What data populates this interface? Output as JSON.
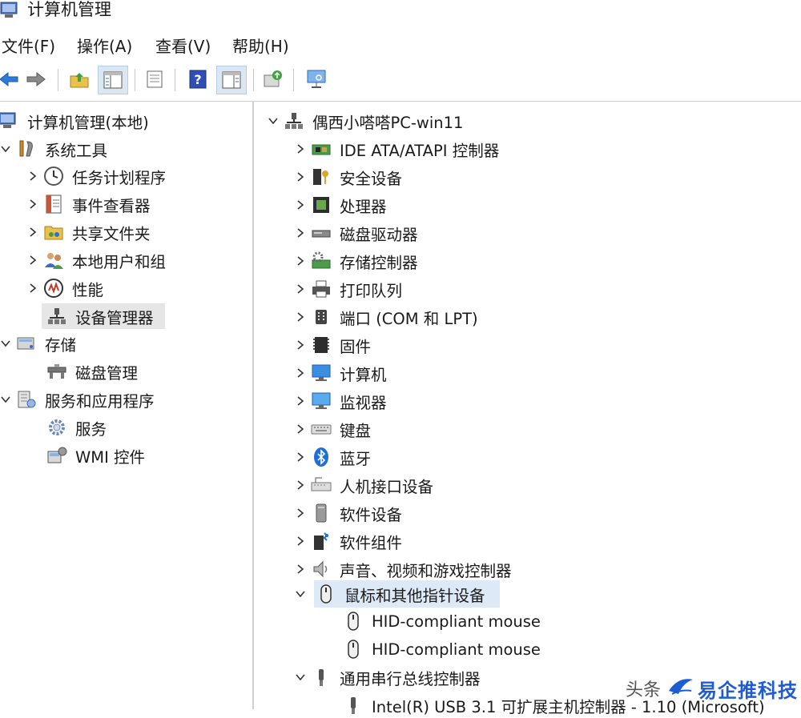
{
  "window": {
    "title": "计算机管理"
  },
  "menu": [
    {
      "label": "文件(F)"
    },
    {
      "label": "操作(A)"
    },
    {
      "label": "查看(V)"
    },
    {
      "label": "帮助(H)"
    }
  ],
  "toolbar": {
    "buttons": [
      "back-arrow-icon",
      "forward-arrow-icon",
      "up-folder-icon",
      "show-tree-icon",
      "properties-icon",
      "help-icon",
      "action-pane-icon",
      "update-driver-icon",
      "scan-hardware-icon"
    ],
    "active": [
      "show-tree-icon",
      "action-pane-icon"
    ]
  },
  "left_tree": [
    {
      "label": "计算机管理(本地)",
      "icon": "computer-management-icon",
      "expander": "none"
    },
    {
      "label": "系统工具",
      "icon": "system-tools-icon",
      "expander": "expanded"
    },
    {
      "label": "任务计划程序",
      "icon": "clock-icon",
      "expander": "collapsed"
    },
    {
      "label": "事件查看器",
      "icon": "event-viewer-icon",
      "expander": "collapsed"
    },
    {
      "label": "共享文件夹",
      "icon": "shared-folder-icon",
      "expander": "collapsed"
    },
    {
      "label": "本地用户和组",
      "icon": "users-icon",
      "expander": "collapsed"
    },
    {
      "label": "性能",
      "icon": "performance-icon",
      "expander": "collapsed"
    },
    {
      "label": "设备管理器",
      "icon": "device-manager-icon",
      "expander": "none",
      "selected": true
    },
    {
      "label": "存储",
      "icon": "storage-icon",
      "expander": "expanded"
    },
    {
      "label": "磁盘管理",
      "icon": "disk-management-icon",
      "expander": "none"
    },
    {
      "label": "服务和应用程序",
      "icon": "services-apps-icon",
      "expander": "expanded"
    },
    {
      "label": "服务",
      "icon": "gear-icon",
      "expander": "none"
    },
    {
      "label": "WMI 控件",
      "icon": "wmi-icon",
      "expander": "none"
    }
  ],
  "right_tree": [
    {
      "label": "偶西小嗒嗒PC-win11",
      "icon": "computer-root-icon",
      "expander": "expanded"
    },
    {
      "label": "IDE ATA/ATAPI 控制器",
      "icon": "ide-controller-icon",
      "expander": "collapsed"
    },
    {
      "label": "安全设备",
      "icon": "security-device-icon",
      "expander": "collapsed"
    },
    {
      "label": "处理器",
      "icon": "processor-icon",
      "expander": "collapsed"
    },
    {
      "label": "磁盘驱动器",
      "icon": "disk-drive-icon",
      "expander": "collapsed"
    },
    {
      "label": "存储控制器",
      "icon": "storage-controller-icon",
      "expander": "collapsed"
    },
    {
      "label": "打印队列",
      "icon": "printer-icon",
      "expander": "collapsed"
    },
    {
      "label": "端口 (COM 和 LPT)",
      "icon": "port-icon",
      "expander": "collapsed"
    },
    {
      "label": "固件",
      "icon": "firmware-icon",
      "expander": "collapsed"
    },
    {
      "label": "计算机",
      "icon": "computer-icon",
      "expander": "collapsed"
    },
    {
      "label": "监视器",
      "icon": "monitor-icon",
      "expander": "collapsed"
    },
    {
      "label": "键盘",
      "icon": "keyboard-icon",
      "expander": "collapsed"
    },
    {
      "label": "蓝牙",
      "icon": "bluetooth-icon",
      "expander": "collapsed"
    },
    {
      "label": "人机接口设备",
      "icon": "hid-icon",
      "expander": "collapsed"
    },
    {
      "label": "软件设备",
      "icon": "software-device-icon",
      "expander": "collapsed"
    },
    {
      "label": "软件组件",
      "icon": "software-component-icon",
      "expander": "collapsed"
    },
    {
      "label": "声音、视频和游戏控制器",
      "icon": "speaker-icon",
      "expander": "collapsed"
    },
    {
      "label": "鼠标和其他指针设备",
      "icon": "mouse-icon",
      "expander": "expanded",
      "highlighted": true
    },
    {
      "label": "HID-compliant mouse",
      "icon": "mouse-icon",
      "expander": "none"
    },
    {
      "label": "HID-compliant mouse",
      "icon": "mouse-icon",
      "expander": "none"
    },
    {
      "label": "通用串行总线控制器",
      "icon": "usb-icon",
      "expander": "expanded"
    },
    {
      "label": "Intel(R) USB 3.1 可扩展主机控制器 - 1.10 (Microsoft)",
      "icon": "usb-plug-icon",
      "expander": "none"
    }
  ],
  "watermark": {
    "prefix": "头条",
    "brand": "易企推科技"
  }
}
